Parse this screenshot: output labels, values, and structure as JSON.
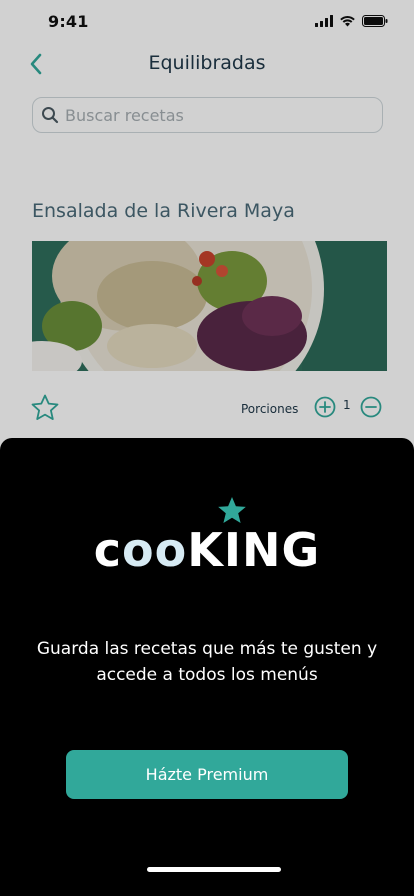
{
  "status_bar": {
    "time": "9:41"
  },
  "header": {
    "title": "Equilibradas"
  },
  "search": {
    "placeholder": "Buscar recetas"
  },
  "recipe": {
    "title": "Ensalada de la Rivera Maya",
    "favorite": false,
    "portions_label": "Porciones",
    "portions": "1"
  },
  "premium_sheet": {
    "logo": {
      "part1": "c",
      "part2": "oo",
      "part3": "KING"
    },
    "message": "Guarda las recetas que más te gusten y accede a todos los menús",
    "button_label": "Házte Premium"
  },
  "colors": {
    "accent": "#31a89a",
    "title_text": "#20394a",
    "sheet_background": "#000000"
  },
  "icons": {
    "back": "chevron-left-icon",
    "search": "magnifier-icon",
    "favorite": "star-outline-icon",
    "increase": "plus-circle-icon",
    "decrease": "minus-circle-icon",
    "logo_star": "star-filled-icon"
  }
}
